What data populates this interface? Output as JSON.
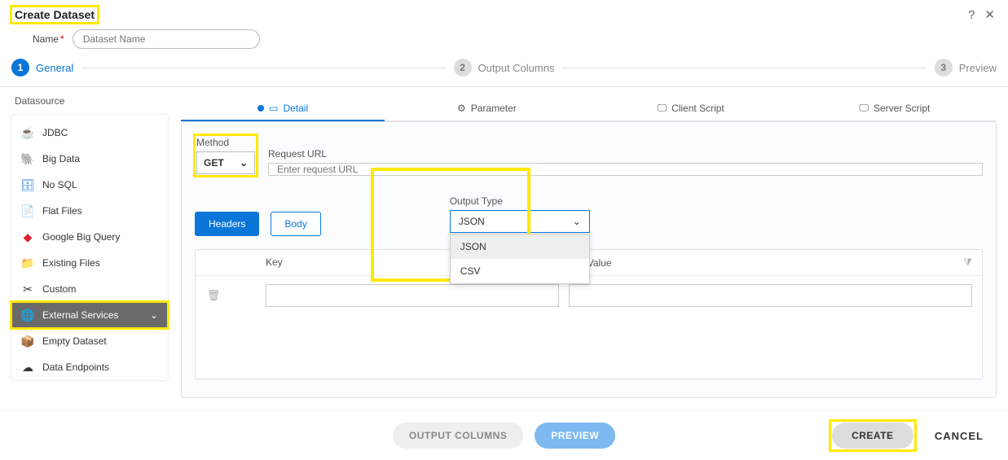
{
  "dialog": {
    "title": "Create Dataset",
    "help": "?",
    "close": "✕"
  },
  "nameField": {
    "label": "Name",
    "required": "*",
    "placeholder": "Dataset Name"
  },
  "stepper": {
    "steps": [
      {
        "num": "1",
        "label": "General"
      },
      {
        "num": "2",
        "label": "Output Columns"
      },
      {
        "num": "3",
        "label": "Preview"
      }
    ]
  },
  "sidebar": {
    "heading": "Datasource",
    "items": [
      {
        "label": "JDBC",
        "icon": "☕"
      },
      {
        "label": "Big Data",
        "icon": "🐘"
      },
      {
        "label": "No SQL",
        "icon": "🗄"
      },
      {
        "label": "Flat Files",
        "icon": "📄"
      },
      {
        "label": "Google Big Query",
        "icon": "◆"
      },
      {
        "label": "Existing Files",
        "icon": "📁"
      },
      {
        "label": "Custom",
        "icon": "✂"
      },
      {
        "label": "External Services",
        "icon": "🌐"
      },
      {
        "label": "Empty Dataset",
        "icon": "📦"
      },
      {
        "label": "Data Endpoints",
        "icon": "☁"
      }
    ]
  },
  "tabs": {
    "items": [
      {
        "label": "Detail"
      },
      {
        "label": "Parameter"
      },
      {
        "label": "Client Script"
      },
      {
        "label": "Server Script"
      }
    ]
  },
  "form": {
    "methodLabel": "Method",
    "methodValue": "GET",
    "urlLabel": "Request URL",
    "urlPlaceholder": "Enter request URL",
    "headersBtn": "Headers",
    "bodyBtn": "Body",
    "outputLabel": "Output Type",
    "outputValue": "JSON",
    "outputOptions": [
      "JSON",
      "CSV"
    ],
    "keyHeader": "Key",
    "valueHeader": "Value"
  },
  "footer": {
    "outputColumns": "OUTPUT COLUMNS",
    "preview": "PREVIEW",
    "create": "CREATE",
    "cancel": "CANCEL"
  }
}
